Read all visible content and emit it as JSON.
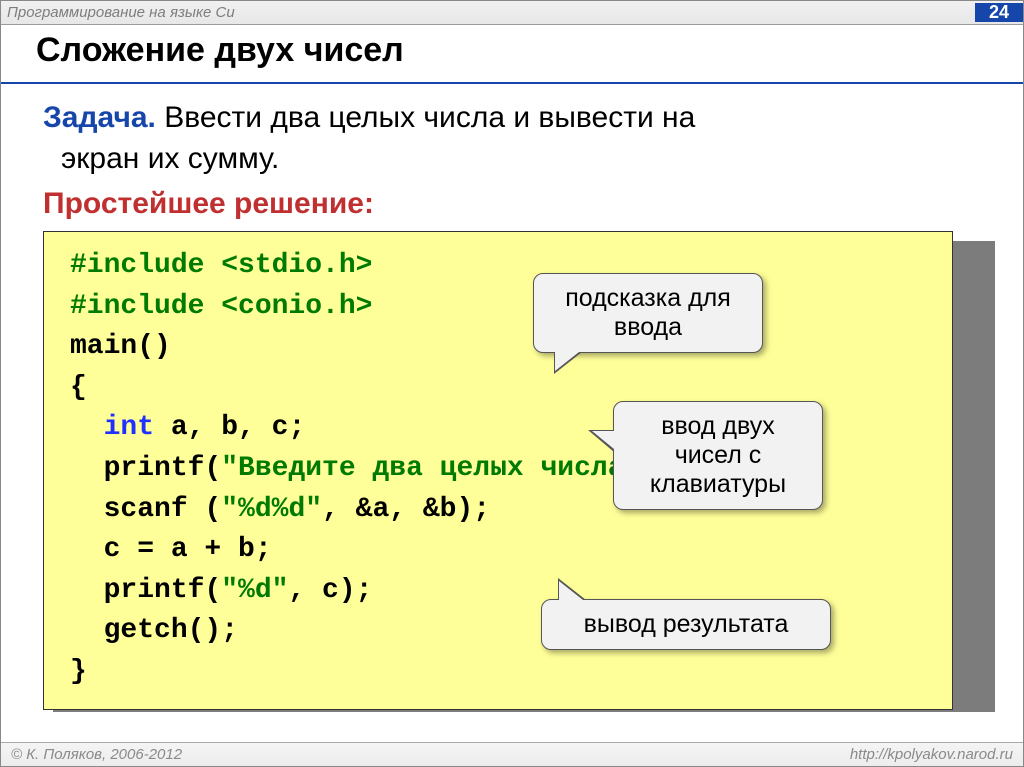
{
  "header": {
    "breadcrumb": "Программирование на языке Си",
    "page_number": "24"
  },
  "title": "Сложение двух чисел",
  "task": {
    "label": "Задача.",
    "line1_rest": " Ввести два целых числа и вывести на",
    "line2": "экран их сумму."
  },
  "solution_label": "Простейшее решение:",
  "code": {
    "l1a": "#include <stdio.h>",
    "l2a": "#include <conio.h>",
    "l3a": "main()",
    "l4a": "{",
    "l5a": "  ",
    "l5b": "int",
    "l5c": " a, b, c;",
    "l6a": "  printf(",
    "l6b": "\"Введите два целых числа\\n\"",
    "l6c": ");",
    "l7a": "  scanf (",
    "l7b": "\"%d%d\"",
    "l7c": ", &a, &b);",
    "l8a": "  c = a + b;",
    "l9a": "  printf(",
    "l9b": "\"%d\"",
    "l9c": ", c);",
    "l10a": "  getch();",
    "l11a": "}"
  },
  "callouts": {
    "c1_l1": "подсказка для",
    "c1_l2": "ввода",
    "c2_l1": "ввод двух",
    "c2_l2": "чисел с",
    "c2_l3": "клавиатуры",
    "c3_l1": "вывод результата"
  },
  "footer": {
    "left": "© К. Поляков, 2006-2012",
    "right": "http://kpolyakov.narod.ru"
  }
}
